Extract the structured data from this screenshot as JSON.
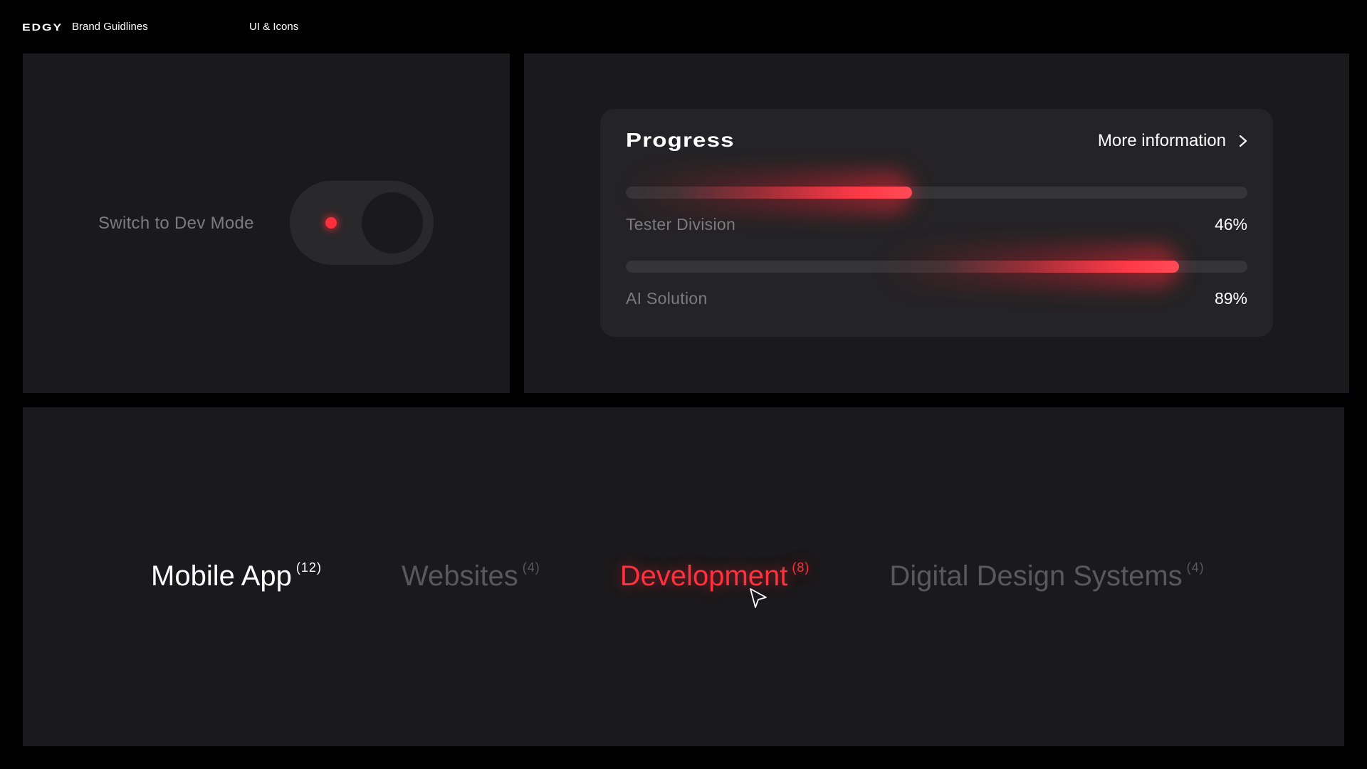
{
  "header": {
    "logo": "EDGY",
    "title": "Brand Guidlines",
    "section": "UI & Icons"
  },
  "toggle": {
    "label": "Switch to Dev Mode",
    "state": "off"
  },
  "progress": {
    "title": "Progress",
    "more_link": "More information",
    "more_icon": "chevron-right-icon",
    "rows": [
      {
        "label": "Tester Division",
        "value_text": "46%",
        "value": 0.46
      },
      {
        "label": "AI Solution",
        "value_text": "89%",
        "value": 0.89
      }
    ]
  },
  "tabs": [
    {
      "label": "Mobile App",
      "count": "(12)",
      "state": "active"
    },
    {
      "label": "Websites",
      "count": "(4)",
      "state": "inactive"
    },
    {
      "label": "Development",
      "count": "(8)",
      "state": "hover"
    },
    {
      "label": "Digital Design Systems",
      "count": "(4)",
      "state": "inactive"
    }
  ],
  "colors": {
    "background": "#000000",
    "panel": "#1a191b",
    "card": "#242325",
    "accent": "#ff313d",
    "muted_text": "#7c7b7f",
    "inactive_tab": "#59585c"
  }
}
